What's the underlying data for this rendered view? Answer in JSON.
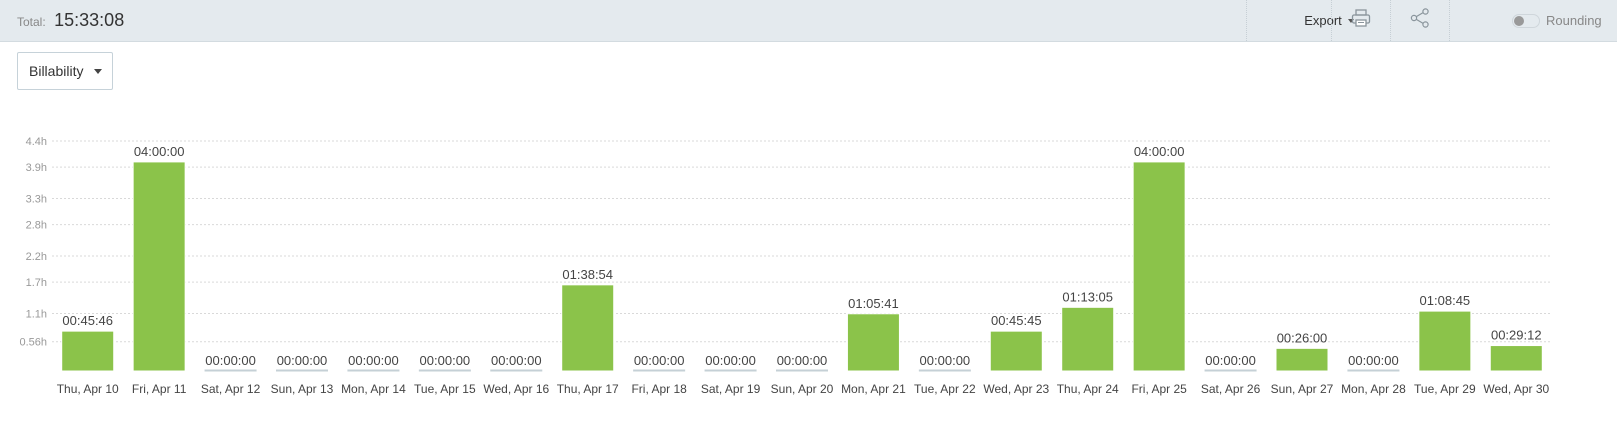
{
  "header": {
    "total_label": "Total:",
    "total_value": "15:33:08",
    "export_label": "Export",
    "print_icon": "print-icon",
    "share_icon": "share-icon",
    "rounding_label": "Rounding",
    "rounding_enabled": false
  },
  "filter": {
    "group_by": "Billability"
  },
  "colors": {
    "bar": "#8bc34a",
    "empty_bar": "#c5d0d6",
    "grid": "#d9d9d9"
  },
  "chart_data": {
    "type": "bar",
    "categories": [
      "Thu, Apr 10",
      "Fri, Apr 11",
      "Sat, Apr 12",
      "Sun, Apr 13",
      "Mon, Apr 14",
      "Tue, Apr 15",
      "Wed, Apr 16",
      "Thu, Apr 17",
      "Fri, Apr 18",
      "Sat, Apr 19",
      "Sun, Apr 20",
      "Mon, Apr 21",
      "Tue, Apr 22",
      "Wed, Apr 23",
      "Thu, Apr 24",
      "Fri, Apr 25",
      "Sat, Apr 26",
      "Sun, Apr 27",
      "Mon, Apr 28",
      "Tue, Apr 29",
      "Wed, Apr 30"
    ],
    "values": [
      0.7628,
      4.0,
      0,
      0,
      0,
      0,
      0,
      1.6483,
      0,
      0,
      0,
      1.0947,
      0,
      0.7625,
      1.2181,
      4.0,
      0,
      0.4333,
      0,
      1.1458,
      0.4867
    ],
    "labels": [
      "00:45:46",
      "04:00:00",
      "00:00:00",
      "00:00:00",
      "00:00:00",
      "00:00:00",
      "00:00:00",
      "01:38:54",
      "00:00:00",
      "00:00:00",
      "00:00:00",
      "01:05:41",
      "00:00:00",
      "00:45:45",
      "01:13:05",
      "04:00:00",
      "00:00:00",
      "00:26:00",
      "00:00:00",
      "01:08:45",
      "00:29:12"
    ],
    "yticks": [
      0.56,
      1.1,
      1.7,
      2.2,
      2.8,
      3.3,
      3.9,
      4.4
    ],
    "ytick_labels": [
      "0.56h",
      "1.1h",
      "1.7h",
      "2.2h",
      "2.8h",
      "3.3h",
      "3.9h",
      "4.4h"
    ],
    "ylim": [
      0,
      4.4
    ],
    "grid": true,
    "unit": "h"
  }
}
